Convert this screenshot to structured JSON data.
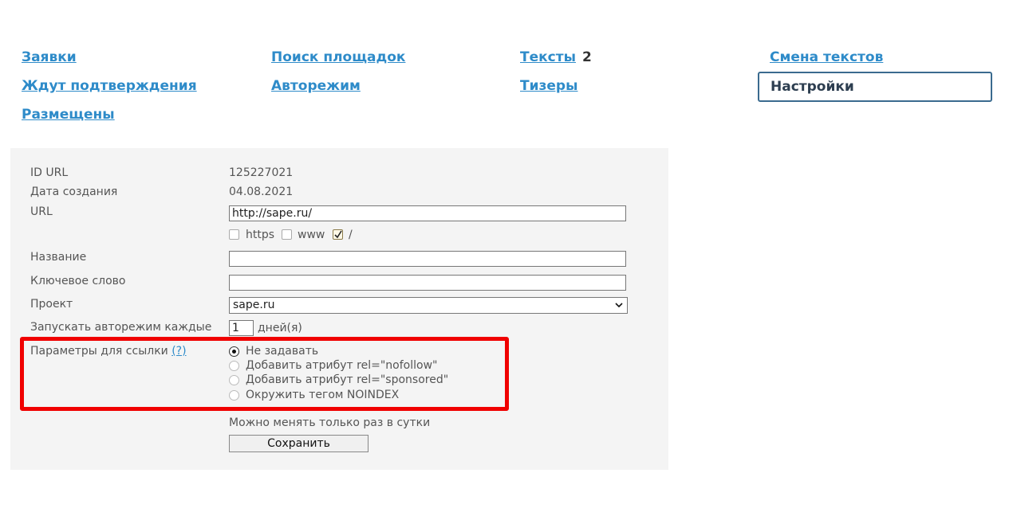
{
  "nav": {
    "applications": "Заявки",
    "awaiting": "Ждут подтверждения",
    "placed": "Размещены",
    "site_search": "Поиск площадок",
    "automode": "Авторежим",
    "texts": "Тексты",
    "texts_count": "2",
    "teasers": "Тизеры",
    "change_texts": "Смена текстов",
    "settings": "Настройки"
  },
  "form": {
    "id_url_label": "ID URL",
    "id_url_value": "125227021",
    "created_label": "Дата создания",
    "created_value": "04.08.2021",
    "url_label": "URL",
    "url_value": "http://sape.ru/",
    "opt_https": "https",
    "opt_www": "www",
    "opt_slash": "/",
    "name_label": "Название",
    "name_value": "",
    "keyword_label": "Ключевое слово",
    "keyword_value": "",
    "project_label": "Проект",
    "project_value": "sape.ru",
    "automode_label": "Запускать авторежим каждые",
    "automode_value": "1",
    "automode_unit": "дней(я)",
    "link_params_label": "Параметры для ссылки",
    "help_link": "(?)",
    "radio_options": [
      "Не задавать",
      "Добавить атрибут rel=\"nofollow\"",
      "Добавить атрибут rel=\"sponsored\"",
      "Окружить тегом NOINDEX"
    ],
    "selected_option": 0,
    "note": "Можно менять только раз в сутки",
    "save_label": "Сохранить"
  },
  "colors": {
    "link": "#2e8bc9",
    "highlight": "#f00000",
    "panel_bg": "#f4f4f4"
  }
}
